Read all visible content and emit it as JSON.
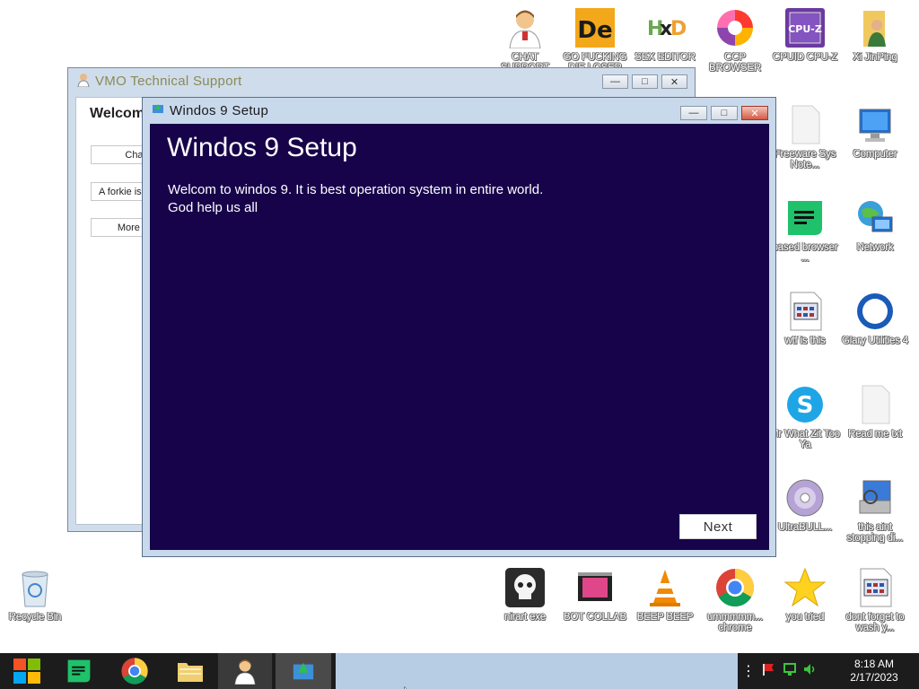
{
  "desktop": {
    "icons_top": [
      {
        "id": "chat-support",
        "label": "CHAT SUPPORT"
      },
      {
        "id": "go-fucking",
        "label": "GO FUCKING DIE LOSER"
      },
      {
        "id": "hxd",
        "label": "SEX EDITOR"
      },
      {
        "id": "ccp-browser",
        "label": "CCP BROWSER"
      },
      {
        "id": "cpuz",
        "label": "CPUID CPU-Z"
      },
      {
        "id": "xi",
        "label": "Xi JinPing"
      }
    ],
    "icons_right": [
      {
        "id": "freeware",
        "label": "Freeware Sys Note..."
      },
      {
        "id": "computer",
        "label": "Computer"
      },
      {
        "id": "based-browser",
        "label": "based browser ..."
      },
      {
        "id": "network",
        "label": "Network"
      },
      {
        "id": "wtf",
        "label": "wtf is this"
      },
      {
        "id": "glary",
        "label": "Glary Utilities 4"
      },
      {
        "id": "mr-what",
        "label": "Mr What Zit Too Ya"
      },
      {
        "id": "readme",
        "label": "Read me txt"
      },
      {
        "id": "ultrabull",
        "label": "UltraBULL..."
      },
      {
        "id": "this-aint",
        "label": "this aint stopping di..."
      }
    ],
    "icons_bottom": [
      {
        "id": "nirart",
        "label": "nirart exe"
      },
      {
        "id": "bot-collab",
        "label": "BOT COLLAB"
      },
      {
        "id": "beep",
        "label": "BEEP BEEP"
      },
      {
        "id": "ummm-chrome",
        "label": "ummmmm... chrome"
      },
      {
        "id": "you-tried",
        "label": "you tried"
      },
      {
        "id": "dont-forget",
        "label": "dont forget to wash y..."
      }
    ],
    "recycle_bin": "Recycle Bin"
  },
  "vmo_window": {
    "title": "VMO Technical Support",
    "heading": "Welcom",
    "buttons": [
      "Chat",
      "A forkie is",
      "More he"
    ]
  },
  "setup_window": {
    "title": "Windos 9 Setup",
    "heading": "Windos 9 Setup",
    "line1": "Welcom to windos 9. It is best operation system in entire world.",
    "line2": "God help us all",
    "next_label": "Next"
  },
  "taskbar": {
    "time": "8:18 AM",
    "date": "2/17/2023"
  }
}
